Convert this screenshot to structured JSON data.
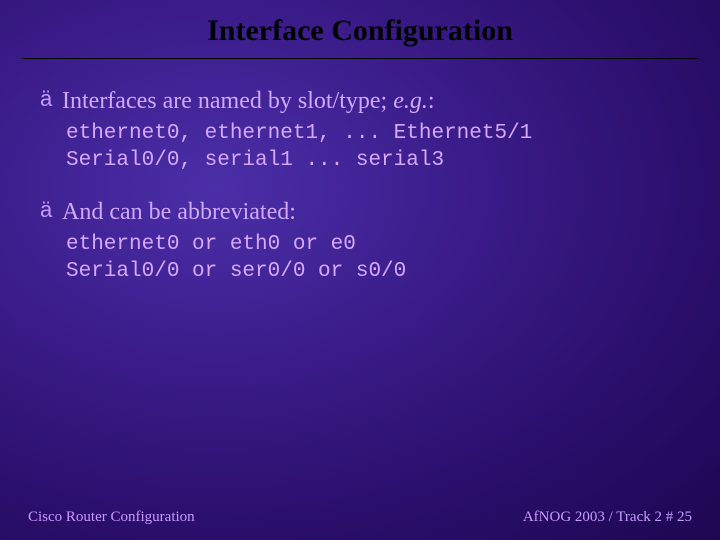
{
  "title": "Interface Configuration",
  "bullets": [
    {
      "lead_plain": "Interfaces are named by slot/type; ",
      "lead_italic": "e.g.",
      "lead_tail": ":",
      "code": "ethernet0, ethernet1, ... Ethernet5/1\nSerial0/0, serial1 ... serial3"
    },
    {
      "lead_plain": "And can be abbreviated:",
      "lead_italic": "",
      "lead_tail": "",
      "code": "ethernet0 or eth0 or e0\nSerial0/0 or ser0/0 or s0/0"
    }
  ],
  "footer": {
    "left": "Cisco Router Configuration",
    "right": "AfNOG 2003 / Track 2  # 25"
  },
  "arrow_glyph": "ä"
}
